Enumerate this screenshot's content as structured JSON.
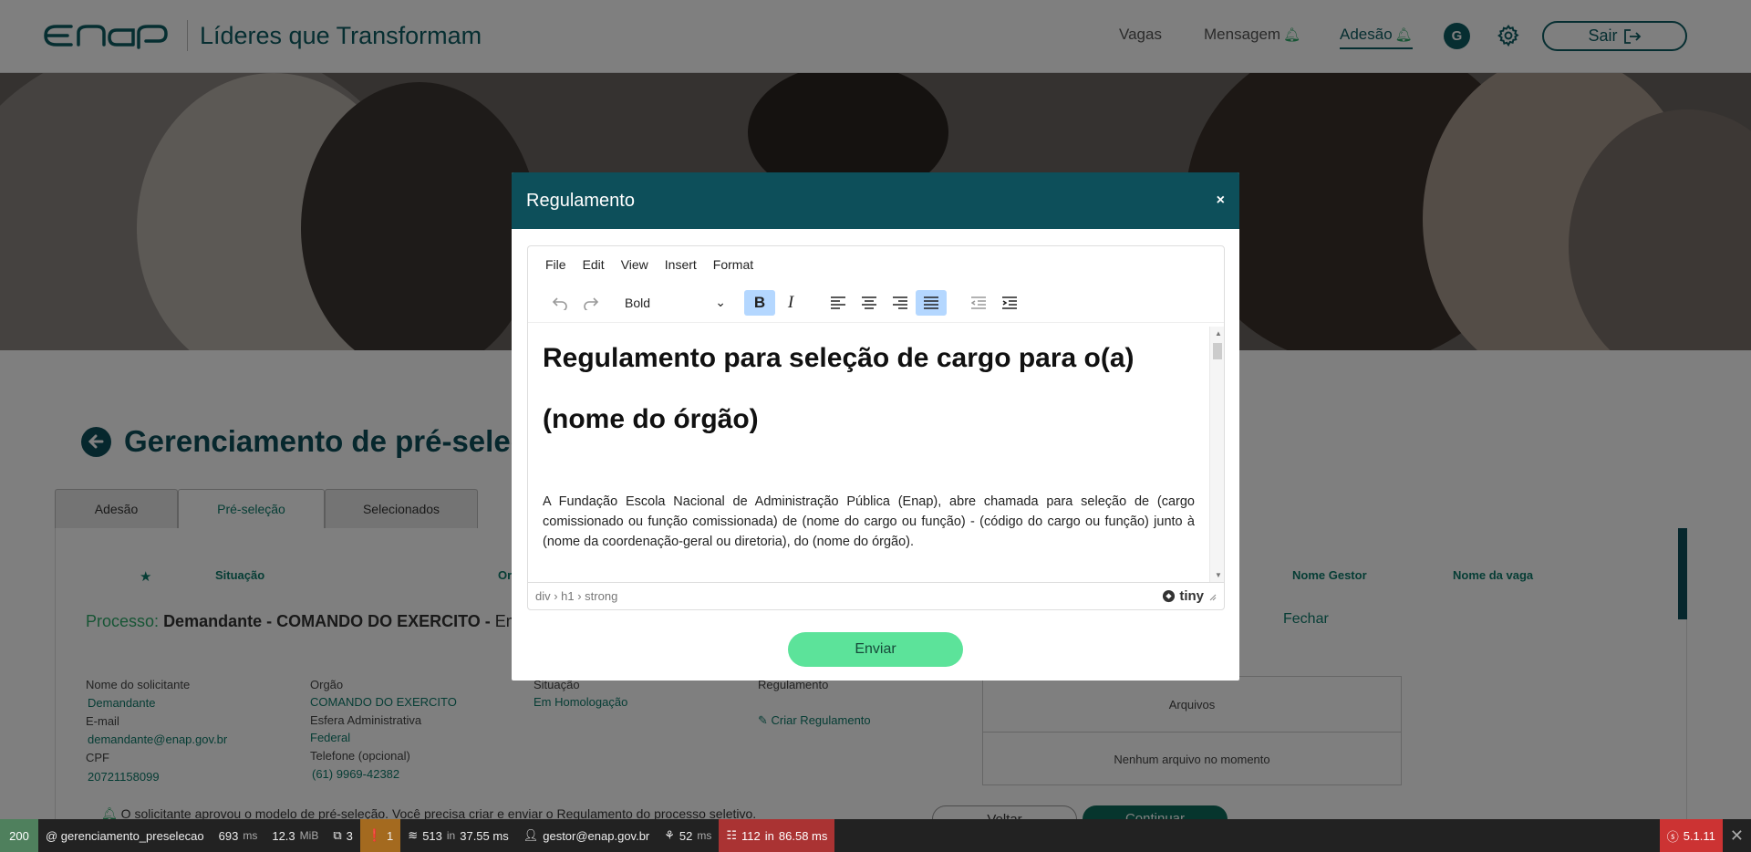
{
  "header": {
    "tagline": "Líderes que Transformam",
    "nav": [
      {
        "label": "Vagas"
      },
      {
        "label": "Mensagem"
      },
      {
        "label": "Adesão"
      }
    ],
    "avatar": "G",
    "logout": "Sair"
  },
  "page": {
    "title": "Gerenciamento de pré-seleç",
    "tabs": [
      {
        "label": "Adesão"
      },
      {
        "label": "Pré-seleção"
      },
      {
        "label": "Selecionados"
      }
    ],
    "columns": [
      "Situação",
      "Or",
      "Nome Gestor",
      "Nome da vaga"
    ],
    "process_label": "Processo:",
    "process_value": "Demandante - COMANDO DO EXERCITO -",
    "process_suffix": "Em H",
    "close_link": "Fechar",
    "fields": {
      "solicitante_label": "Nome do solicitante",
      "solicitante": "Demandante",
      "email_label": "E-mail",
      "email": "demandante@enap.gov.br",
      "cpf_label": "CPF",
      "cpf": "20721158099",
      "orgao_label": "Orgão",
      "orgao": "COMANDO DO EXERCITO",
      "esfera_label": "Esfera Administrativa",
      "esfera": "Federal",
      "telefone_label": "Telefone (opcional)",
      "telefone": "(61) 9969-42382",
      "situacao_label": "Situação",
      "situacao": "Em Homologação",
      "regulamento_label": "Regulamento",
      "criar": "Criar Regulamento"
    },
    "files_header": "Arquivos",
    "files_empty": "Nenhum arquivo no momento",
    "notice": "O solicitante aprovou o modelo de pré-seleção. Você precisa criar e enviar o Regulamento do processo seletivo.",
    "btn_back": "Voltar",
    "btn_continue": "Continuar"
  },
  "modal": {
    "title": "Regulamento",
    "close": "×",
    "menu": [
      "File",
      "Edit",
      "View",
      "Insert",
      "Format"
    ],
    "format_select": "Bold",
    "heading": "Regulamento para seleção de cargo para o(a) (nome do órgão)",
    "paragraph": "A Fundação Escola Nacional de Administração Pública (Enap), abre chamada para seleção de (cargo comissionado ou função comissionada) de (nome do cargo ou função) - (código do cargo ou função) junto à (nome da coordenação-geral ou diretoria), do (nome do órgão).",
    "path": "div › h1 › strong",
    "brand": "tiny",
    "submit": "Enviar"
  },
  "debug": {
    "status": "200",
    "route": "@ gerenciamento_preselecao",
    "time": "693",
    "time_unit": "ms",
    "memory": "12.3",
    "memory_unit": "MiB",
    "forms": "3",
    "logs": "1",
    "cache": "513",
    "cache_in": "in",
    "cache_time": "37.55 ms",
    "user": "gestor@enap.gov.br",
    "twig": "52",
    "twig_unit": "ms",
    "db": "112",
    "db_in": "in",
    "db_time": "86.58 ms",
    "version": "5.1.11"
  },
  "colors": {
    "primary": "#0d4f5a",
    "accent": "#0d7a6a",
    "submit": "#5ce39a",
    "db_badge": "#a33",
    "version_badge": "#c33"
  }
}
